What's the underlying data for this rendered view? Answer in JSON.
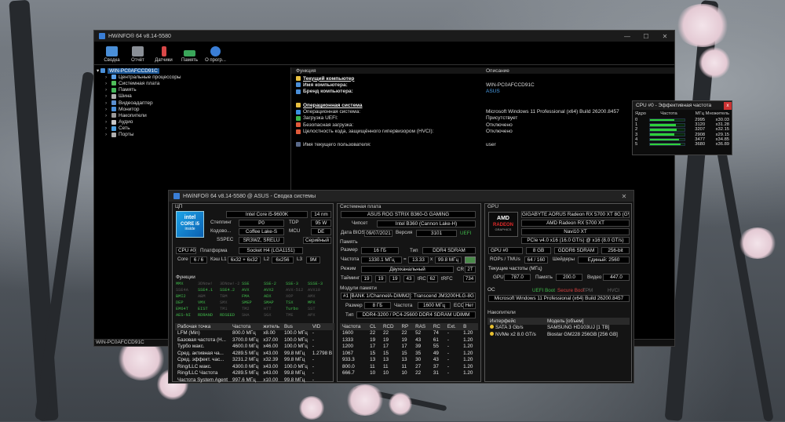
{
  "main_window": {
    "title": "HWiNFO® 64 v8.14-5580",
    "controls": [
      "—",
      "☐",
      "✕"
    ],
    "toolbar": [
      {
        "label": "Сводка",
        "icon": "monitor-icon",
        "color": "#4a8fd8"
      },
      {
        "label": "Отчёт",
        "icon": "save-icon",
        "color": "#8a8f96"
      },
      {
        "label": "Датчики",
        "icon": "thermometer-icon",
        "color": "#d84848"
      },
      {
        "label": "Память",
        "icon": "memory-icon",
        "color": "#3aa65a"
      },
      {
        "label": "О прогр...",
        "icon": "info-icon",
        "color": "#3a7ed6"
      }
    ],
    "tree": {
      "root": "WIN-PC0AFCCD91C",
      "items": [
        {
          "label": "Центральные процессоры",
          "color": "#5aa0e8"
        },
        {
          "label": "Системная плата",
          "color": "#4fbf5a"
        },
        {
          "label": "Память",
          "color": "#45b85a"
        },
        {
          "label": "Шина",
          "color": "#b0b0b0"
        },
        {
          "label": "Видеоадаптер",
          "color": "#5a8fd0"
        },
        {
          "label": "Монитор",
          "color": "#4a8ed8"
        },
        {
          "label": "Накопители",
          "color": "#9a9a9a"
        },
        {
          "label": "Аудио",
          "color": "#c8c8c8"
        },
        {
          "label": "Сеть",
          "color": "#4ea0e0"
        },
        {
          "label": "Порты",
          "color": "#b0b0b0"
        }
      ]
    },
    "table": {
      "col1": "Функция",
      "col2": "Описание",
      "rows": [
        {
          "f": "Текущий компьютер",
          "d": "",
          "type": "section",
          "icon": "#e8c040"
        },
        {
          "f": "Имя компьютера:",
          "d": "WIN-PC0AFCCD91C",
          "type": "bold",
          "icon": "#4a8fd8"
        },
        {
          "f": "Бренд компьютера:",
          "d": "ASUS",
          "type": "bold",
          "icon": "#4a8fd8",
          "dcolor": "#4a9ee8"
        },
        {
          "f": "",
          "d": "",
          "type": "blank"
        },
        {
          "f": "Операционная система",
          "d": "",
          "type": "section",
          "icon": "#e8c040"
        },
        {
          "f": "Операционная система:",
          "d": "Microsoft Windows 11 Professional (x64) Build 26200.8457",
          "type": "plain",
          "icon": "#3a8fe0"
        },
        {
          "f": "Загрузка UEFI:",
          "d": "Присутствует",
          "type": "plain",
          "icon": "#3ab84a"
        },
        {
          "f": "Безопасная загрузка:",
          "d": "Отключено",
          "type": "plain",
          "icon": "#e05a3a"
        },
        {
          "f": "Целостность кода, защищённого гипервизором (HVCI):",
          "d": "Отключено",
          "type": "plain",
          "icon": "#e05a3a"
        },
        {
          "f": "",
          "d": "",
          "type": "blank"
        },
        {
          "f": "Имя текущего пользователя:",
          "d": "user",
          "type": "plain",
          "icon": "#5a6a8a"
        }
      ]
    },
    "statusbar": "WIN-PC0AFCCD91C"
  },
  "freq_window": {
    "title": "CPU #0 - Эффективная частота",
    "close": "x",
    "headers": [
      "Ядро",
      "Частота",
      "МГц",
      "Множитель"
    ],
    "rows": [
      {
        "core": "0",
        "fill": 0.72,
        "mhz": "2995",
        "mult": "x30.03"
      },
      {
        "core": "1",
        "fill": 0.75,
        "mhz": "3120",
        "mult": "x31.28"
      },
      {
        "core": "2",
        "fill": 0.78,
        "mhz": "3207",
        "mult": "x32.15"
      },
      {
        "core": "3",
        "fill": 0.7,
        "mhz": "2908",
        "mult": "x29.15"
      },
      {
        "core": "4",
        "fill": 0.84,
        "mhz": "3477",
        "mult": "x34.85"
      },
      {
        "core": "5",
        "fill": 0.88,
        "mhz": "3680",
        "mult": "x36.89"
      }
    ]
  },
  "summary_window": {
    "title": "HWiNFO® 64 v8.14-5580 @ ASUS  - Сводка системы",
    "close": "✕",
    "cpu": {
      "section": "ЦП",
      "logo_brand": "intel",
      "logo_model": "CORE i5",
      "logo_gen": "inside",
      "name": "Intel Core i5-9600K",
      "nm": "14 nm",
      "stepping_lbl": "Степпинг",
      "stepping": "P0",
      "tdp_lbl": "TDP",
      "tdp": "95 W",
      "codename_lbl": "Кодово...",
      "codename": "Coffee Lake-S",
      "mcu_lbl": "MCU",
      "mcu": "DE",
      "sspec_lbl": "SSPEC",
      "sspec": "SR3WZ, SRELU",
      "prod": "Серийный",
      "cpu_sel": "CPU #0",
      "platform_lbl": "Платформа",
      "platform": "Socket H4 (LGA1151)",
      "cores_lbl": "Core",
      "cores": "6 / 6",
      "l1_lbl": "Кэш L1",
      "l1": "6x32 + 6x32",
      "l2_lbl": "L2",
      "l2": "6x256",
      "l3_lbl": "L3",
      "l3": "9M",
      "features_lbl": "Функции",
      "features": [
        [
          "MMX",
          "3DNow!",
          "3DNow!-2",
          "SSE",
          "SSE-2",
          "SSE-3",
          "SSSE-3"
        ],
        [
          "SSE4A",
          "SSE4.1",
          "SSE4.2",
          "AVX",
          "AVX2",
          "AVX-512",
          "AVX10"
        ],
        [
          "BMI2",
          "ABM",
          "TBM",
          "FMA",
          "ADX",
          "XOP",
          "AMX"
        ],
        [
          "DEP",
          "VMX",
          "SMX",
          "SMEP",
          "SMAP",
          "TSX",
          "MPX"
        ],
        [
          "EM64T",
          "EIST",
          "TM1",
          "TM2",
          "HTT",
          "Turbo",
          "SST"
        ],
        [
          "AES-NI",
          "RDRAND",
          "RDSEED",
          "SHA",
          "SGX",
          "TME",
          "APX"
        ]
      ],
      "features_off": [
        "3DNow!",
        "3DNow!-2",
        "SSE4A",
        "AVX-512",
        "AVX10",
        "ABM",
        "TBM",
        "XOP",
        "AMX",
        "SMX",
        "TM1",
        "TM2",
        "SST",
        "SHA",
        "SGX",
        "TME",
        "APX",
        "HTT"
      ],
      "op_headers": [
        "Рабочая точка",
        "Частота",
        "житель",
        "Bus",
        "VID"
      ],
      "op_rows": [
        [
          "LFM (Min)",
          "800.0 МГц",
          "x8.00",
          "100.0 МГц",
          "-"
        ],
        [
          "Базовая частота (Н...",
          "3700.0 МГц",
          "x37.00",
          "100.0 МГц",
          "-"
        ],
        [
          "Турбо макс.",
          "4600.0 МГц",
          "x46.00",
          "100.0 МГц",
          "-"
        ],
        [
          "Сред. активная ча...",
          "4289.5 МГц",
          "x43.00",
          "99.8 МГц",
          "1.2798 В"
        ],
        [
          "Сред. эффект. час...",
          "3231.2 МГц",
          "x32.39",
          "99.8 МГц",
          "-"
        ],
        [
          "Ring/LLC макс.",
          "4300.0 МГц",
          "x43.00",
          "100.0 МГц",
          "-"
        ],
        [
          "Ring/LLC Частота",
          "4289.5 МГц",
          "x43.00",
          "99.8 МГц",
          "-"
        ],
        [
          "Частота System Agent",
          "997.6 МГц",
          "x10.00",
          "99.8 МГц",
          "-"
        ]
      ]
    },
    "mobo": {
      "section": "Системная плата",
      "name": "ASUS ROG STRIX B360-G GAMING",
      "chipset_lbl": "Чипсет",
      "chipset": "Intel B360 (Cannon Lake-H)",
      "bios_lbl": "Дата BIOS",
      "bios_date": "09/07/2021",
      "ver_lbl": "Версия",
      "ver": "3101",
      "uefi": "UEFI"
    },
    "memory": {
      "section": "Память",
      "size_lbl": "Размер",
      "size": "16 ГБ",
      "type_lbl": "Тип",
      "type": "DDR4 SDRAM",
      "freq_lbl": "Частота",
      "freq": "1330.1 МГц",
      "eq": "=",
      "mult": "13.33",
      "x": "x",
      "bus": "99.8 МГц",
      "mode_lbl": "Режим",
      "mode": "Двухканальный",
      "cr_lbl": "CR",
      "cr": "2T",
      "timing_lbl": "Тайминг",
      "t": [
        "19",
        "19",
        "19",
        "43"
      ],
      "trc_lbl": "tRC",
      "trc": "62",
      "trfc_lbl": "tRFC",
      "trfc": "734",
      "modules_lbl": "Модули памяти",
      "module_sel": "#1 [BANK 1/ChannelA-DIMM2]: Transcend JM3200HLG-8G",
      "msize_lbl": "Размер",
      "msize": "8 ГБ",
      "mfreq_lbl": "Частота",
      "mfreq": "1600 МГц",
      "ecc_lbl": "ECC",
      "ecc": "Нет",
      "mtype_lbl": "Тип",
      "mtype": "DDR4-3200 / PC4-25600 DDR4 SDRAM UDIMM",
      "t_headers": [
        "Частота",
        "CL",
        "RCD",
        "RP",
        "RAS",
        "RC",
        "Ext.",
        "В"
      ],
      "t_rows": [
        [
          "1600",
          "22",
          "22",
          "22",
          "52",
          "74",
          "-",
          "1.20"
        ],
        [
          "1333",
          "19",
          "19",
          "19",
          "43",
          "61",
          "-",
          "1.20"
        ],
        [
          "1200",
          "17",
          "17",
          "17",
          "39",
          "55",
          "-",
          "1.20"
        ],
        [
          "1067",
          "15",
          "15",
          "15",
          "35",
          "49",
          "-",
          "1.20"
        ],
        [
          "933.3",
          "13",
          "13",
          "13",
          "30",
          "43",
          "-",
          "1.20"
        ],
        [
          "800.0",
          "11",
          "11",
          "11",
          "27",
          "37",
          "-",
          "1.20"
        ],
        [
          "666.7",
          "10",
          "10",
          "10",
          "22",
          "31",
          "-",
          "1.20"
        ]
      ]
    },
    "gpu": {
      "section": "GPU",
      "logo_brand": "AMD",
      "logo_model": "RADEON",
      "logo_sub": "GRAPHICS",
      "name": "GIGABYTE AORUS Radeon RX 5700 XT 8G (GV-R57X",
      "chip": "AMD Radeon RX 5700 XT",
      "code": "Navi10 XT",
      "pcie": "PCIe v4.0 x16 (16.0 GT/s) @ x16 (8.0 GT/s)",
      "sel": "GPU #0",
      "mem": "8 GB",
      "memtype": "GDDR6 SDRAM",
      "bus": "256-bit",
      "rops_lbl": "ROPs / TMUs",
      "rops": "64 / 160",
      "shaders_lbl": "Шейдеры",
      "shaders": "Единый: 2560",
      "clocks_lbl": "Текущие частоты (МГц)",
      "gpu_lbl": "GPU",
      "gpu_clk": "787.0",
      "mem_lbl": "Память",
      "mem_clk": "200.0",
      "video_lbl": "Видео",
      "video_clk": "447.0"
    },
    "os": {
      "section": "ОС",
      "flags": [
        {
          "t": "UEFI Boot",
          "on": true
        },
        {
          "t": "Secure Boot",
          "on": false
        },
        {
          "t": "TPM",
          "on": false
        },
        {
          "t": "HVCI",
          "on": false
        }
      ],
      "name": "Microsoft Windows 11 Professional (x64) Build 26200.8457"
    },
    "storage": {
      "section": "Накопители",
      "headers": [
        "Интерфейс",
        "Модель [объем]"
      ],
      "rows": [
        {
          "iface": "SATA 3 Gb/s",
          "model": "SAMSUNG HD103UJ [1 TB]",
          "color": "#e8c030"
        },
        {
          "iface": "NVMe x2 8.0 GT/s",
          "model": "Biostar GM228 256GB [256 GB]",
          "color": "#e8c030"
        }
      ]
    }
  },
  "colors": {
    "accent": "#1f5a9a",
    "ok": "#3fb84a",
    "bad": "#d84040"
  }
}
